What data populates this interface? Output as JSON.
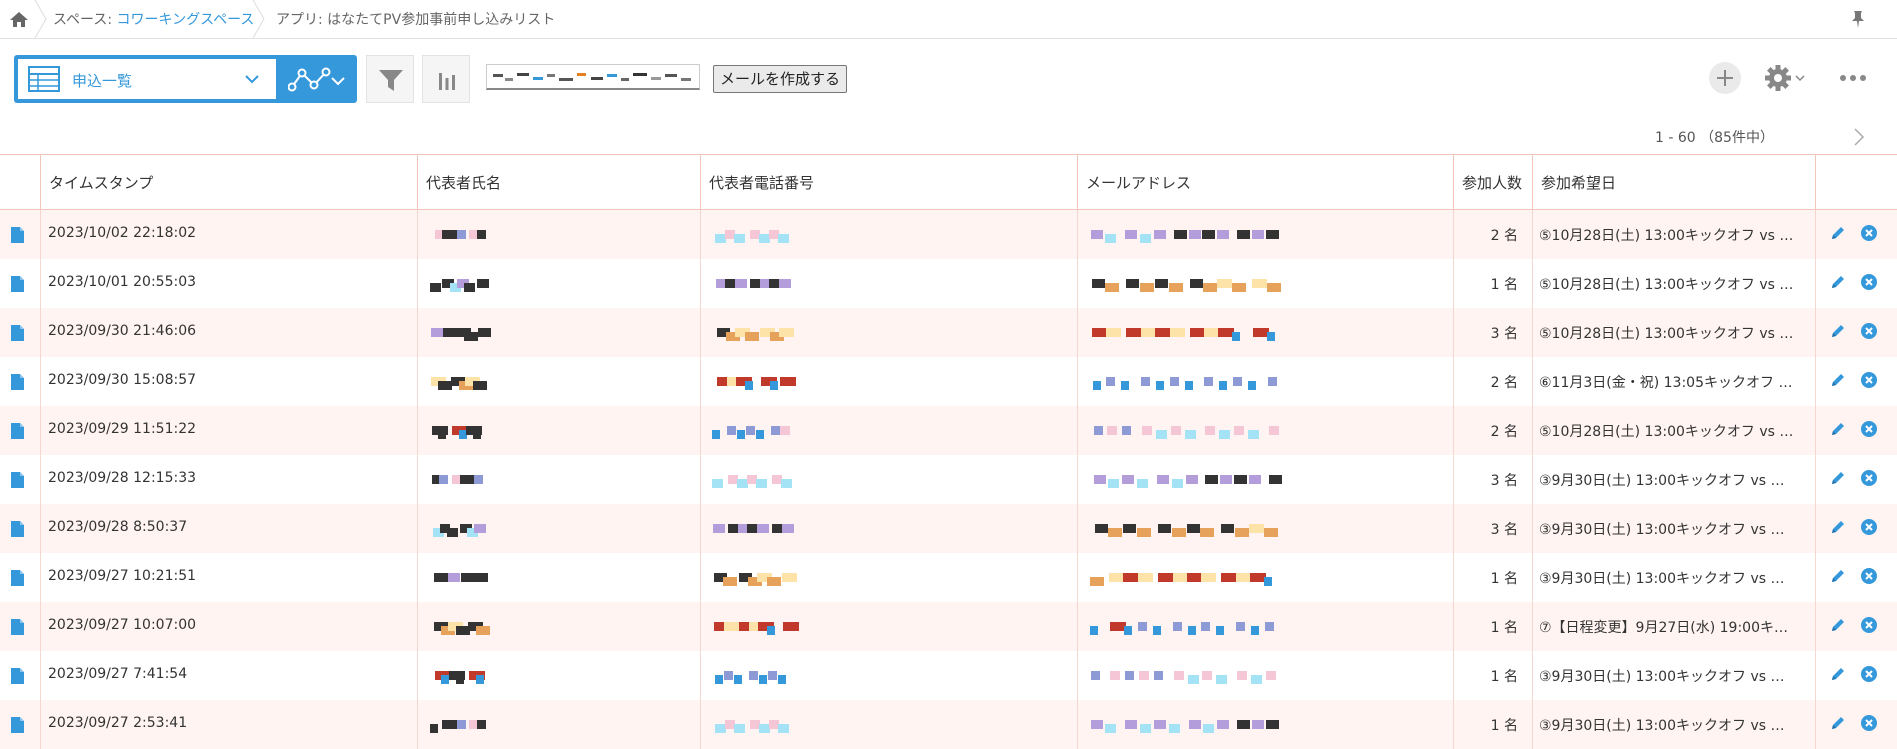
{
  "breadcrumb": {
    "space_prefix": "スペース: ",
    "space_name": "コワーキングスペース",
    "app_prefix": "アプリ: ",
    "app_name": "はなたてPV参加事前申し込みリスト"
  },
  "toolbar": {
    "view_name": "申込一覧",
    "mail_button": "メールを作成する"
  },
  "pager": {
    "range": "1 - 60",
    "total": "（85件中）"
  },
  "columns": [
    "タイムスタンプ",
    "代表者氏名",
    "代表者電話番号",
    "メールアドレス",
    "参加人数",
    "参加希望日"
  ],
  "rows": [
    {
      "timestamp": "2023/10/02 22:18:02",
      "count": "2 名",
      "date": "⑤10月28日(土) 13:00キックオフ vs …"
    },
    {
      "timestamp": "2023/10/01 20:55:03",
      "count": "1 名",
      "date": "⑤10月28日(土) 13:00キックオフ vs …"
    },
    {
      "timestamp": "2023/09/30 21:46:06",
      "count": "3 名",
      "date": "⑤10月28日(土) 13:00キックオフ vs …"
    },
    {
      "timestamp": "2023/09/30 15:08:57",
      "count": "2 名",
      "date": "⑥11月3日(金・祝) 13:05キックオフ …"
    },
    {
      "timestamp": "2023/09/29 11:51:22",
      "count": "2 名",
      "date": "⑤10月28日(土) 13:00キックオフ vs …"
    },
    {
      "timestamp": "2023/09/28 12:15:33",
      "count": "3 名",
      "date": "③9月30日(土) 13:00キックオフ vs …"
    },
    {
      "timestamp": "2023/09/28 8:50:37",
      "count": "3 名",
      "date": "③9月30日(土) 13:00キックオフ vs …"
    },
    {
      "timestamp": "2023/09/27 10:21:51",
      "count": "1 名",
      "date": "③9月30日(土) 13:00キックオフ vs …"
    },
    {
      "timestamp": "2023/09/27 10:07:00",
      "count": "1 名",
      "date": "⑦【日程変更】9月27日(水) 19:00キ…"
    },
    {
      "timestamp": "2023/09/27 7:41:54",
      "count": "1 名",
      "date": "③9月30日(土) 13:00キックオフ vs …"
    },
    {
      "timestamp": "2023/09/27 2:53:41",
      "count": "1 名",
      "date": "③9月30日(土) 13:00キックオフ vs …"
    }
  ],
  "colors": {
    "accent": "#3498db",
    "header_border": "#f1c6b9",
    "row_alt": "#fff4f2"
  }
}
